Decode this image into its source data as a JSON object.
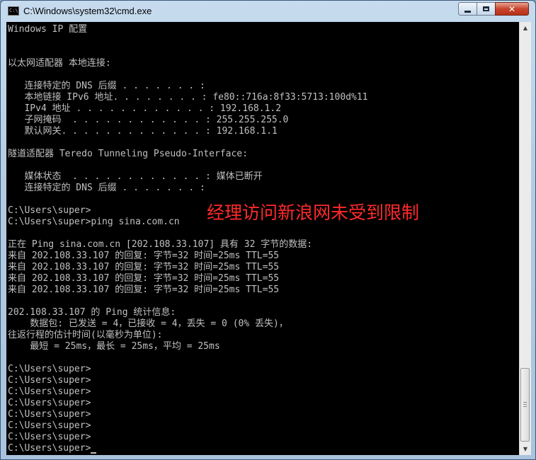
{
  "window": {
    "title": "C:\\Windows\\system32\\cmd.exe",
    "icon": "cmd-console-icon",
    "icon_text": "C:\\",
    "controls": {
      "minimize": "minimize-icon",
      "maximize": "maximize-icon",
      "close": "✕"
    }
  },
  "colors": {
    "console_bg": "#000000",
    "console_text": "#c0c0c0",
    "annotation": "#ff2a2a"
  },
  "console": {
    "lines": [
      "Windows IP 配置",
      "",
      "",
      "以太网适配器 本地连接:",
      "",
      "   连接特定的 DNS 后缀 . . . . . . . :",
      "   本地链接 IPv6 地址. . . . . . . . : fe80::716a:8f33:5713:100d%11",
      "   IPv4 地址 . . . . . . . . . . . . : 192.168.1.2",
      "   子网掩码  . . . . . . . . . . . . : 255.255.255.0",
      "   默认网关. . . . . . . . . . . . . : 192.168.1.1",
      "",
      "隧道适配器 Teredo Tunneling Pseudo-Interface:",
      "",
      "   媒体状态  . . . . . . . . . . . . : 媒体已断开",
      "   连接特定的 DNS 后缀 . . . . . . . :",
      "",
      "C:\\Users\\super>",
      "C:\\Users\\super>ping sina.com.cn",
      "",
      "正在 Ping sina.com.cn [202.108.33.107] 具有 32 字节的数据:",
      "来自 202.108.33.107 的回复: 字节=32 时间=25ms TTL=55",
      "来自 202.108.33.107 的回复: 字节=32 时间=25ms TTL=55",
      "来自 202.108.33.107 的回复: 字节=32 时间=25ms TTL=55",
      "来自 202.108.33.107 的回复: 字节=32 时间=25ms TTL=55",
      "",
      "202.108.33.107 的 Ping 统计信息:",
      "    数据包: 已发送 = 4，已接收 = 4，丢失 = 0 (0% 丢失)，",
      "往返行程的估计时间(以毫秒为单位):",
      "    最短 = 25ms，最长 = 25ms，平均 = 25ms",
      "",
      "C:\\Users\\super>",
      "C:\\Users\\super>",
      "C:\\Users\\super>",
      "C:\\Users\\super>",
      "C:\\Users\\super>",
      "C:\\Users\\super>",
      "C:\\Users\\super>",
      "C:\\Users\\super>"
    ]
  },
  "annotation": {
    "text": "经理访问新浪网未受到限制"
  },
  "scrollbar": {
    "up": "▲",
    "down": "▼"
  }
}
